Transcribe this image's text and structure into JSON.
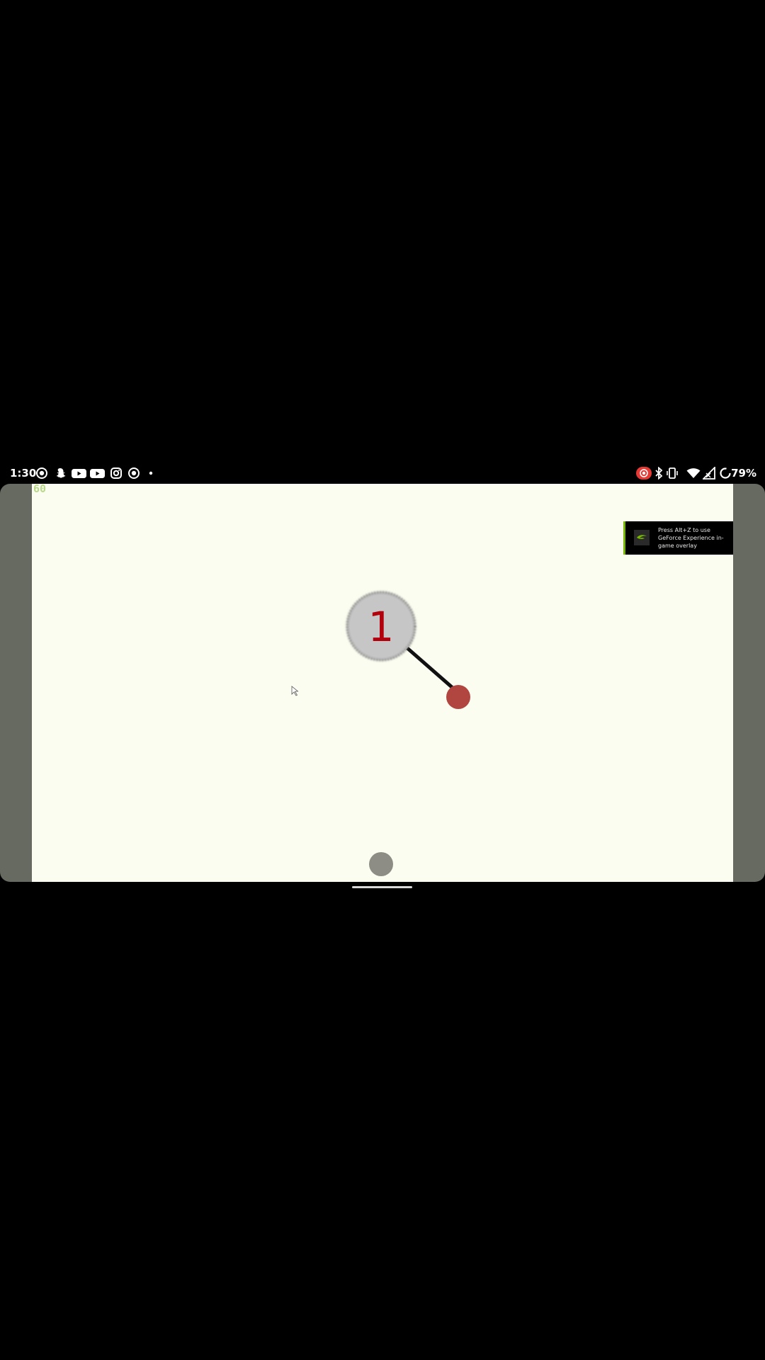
{
  "status_bar": {
    "time": "1:30",
    "battery_percent": "79%",
    "left_icons": [
      "screen-record-icon",
      "snapchat-icon",
      "youtube-icon",
      "youtube-icon",
      "instagram-icon",
      "screen-record-icon",
      "dot-icon"
    ],
    "right_icons": [
      "screen-record-active-icon",
      "bluetooth-icon",
      "vibrate-icon",
      "wifi-icon",
      "signal-icon",
      "battery-ring-icon"
    ],
    "record_color": "#e53935"
  },
  "game": {
    "fps_counter": "60",
    "ball_number": "1",
    "colors": {
      "background": "#fbfdf0",
      "side_bars": "#676a61",
      "main_ball": "#c3c3c3",
      "number": "#b3000d",
      "red_ball": "#b0463f",
      "grey_ball": "#8d8d85",
      "rope": "#111111",
      "fps": "#b9d98a"
    }
  },
  "overlay_notification": {
    "text": "Press Alt+Z to use GeForce Experience in-game overlay",
    "accent_color": "#76b900"
  }
}
